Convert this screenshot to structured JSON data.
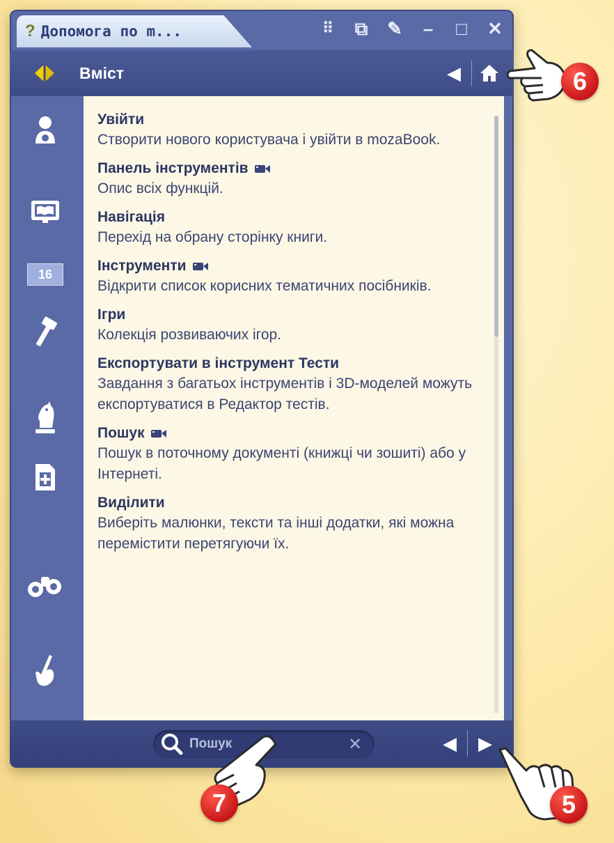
{
  "window": {
    "title": "Допомога по m...",
    "title_icon": "question-mark",
    "titlebar_buttons": [
      {
        "name": "grid-icon",
        "glyph": "⠿"
      },
      {
        "name": "pin-window-icon",
        "glyph": "⧉"
      },
      {
        "name": "pencil-icon",
        "glyph": "✎"
      },
      {
        "name": "minimize-icon",
        "glyph": "–"
      },
      {
        "name": "maximize-icon",
        "glyph": "□"
      },
      {
        "name": "close-icon",
        "glyph": "✕"
      }
    ]
  },
  "header": {
    "title": "Вміст",
    "back_glyph": "◀",
    "home_glyph": "⌂"
  },
  "entries": [
    {
      "title": "Увійти",
      "desc": "Створити нового користувача і увійти в mozaBook.",
      "video": false
    },
    {
      "title": "Панель інструментів",
      "desc": "Опис всіх функцій.",
      "video": true
    },
    {
      "title": "Навігація",
      "desc": "Перехід на обрану сторінку книги.",
      "video": false
    },
    {
      "title": "Інструменти",
      "desc": "Відкрити список корисних тематичних посібників.",
      "video": true
    },
    {
      "title": "Ігри",
      "desc": "Колекція розвиваючих ігор.",
      "video": false
    },
    {
      "title": "Експортувати в інструмент Тести",
      "desc": "Завдання з багатьох інструментів і 3D-моделей можуть експортуватися в Редактор тестів.",
      "video": false
    },
    {
      "title": "Пошук",
      "desc": "Пошук в поточному документі (книжці чи зошиті) або у Інтернеті.",
      "video": true
    },
    {
      "title": "Виділити",
      "desc": "Виберіть малюнки, тексти та інші додатки, які можна перемістити перетягуючи їх.",
      "video": false
    }
  ],
  "sidebar": {
    "page_number": "16",
    "icons": [
      "user-icon",
      "book-icon",
      "page-number-icon",
      "hammer-icon",
      "chess-knight-icon",
      "export-icon",
      "binoculars-icon",
      "pointer-hand-icon"
    ]
  },
  "footer": {
    "search_placeholder": "Пошук",
    "clear_glyph": "✕",
    "prev_glyph": "◀",
    "next_glyph": "▶"
  },
  "callouts": {
    "badge_6": "6",
    "badge_7": "7",
    "badge_5": "5"
  },
  "colors": {
    "window_blue": "#5a6aa6",
    "content_bg": "#fdf7e6",
    "heading_text": "#2c3661",
    "badge_red": "#c8161a",
    "logo_yellow": "#f5d000"
  }
}
